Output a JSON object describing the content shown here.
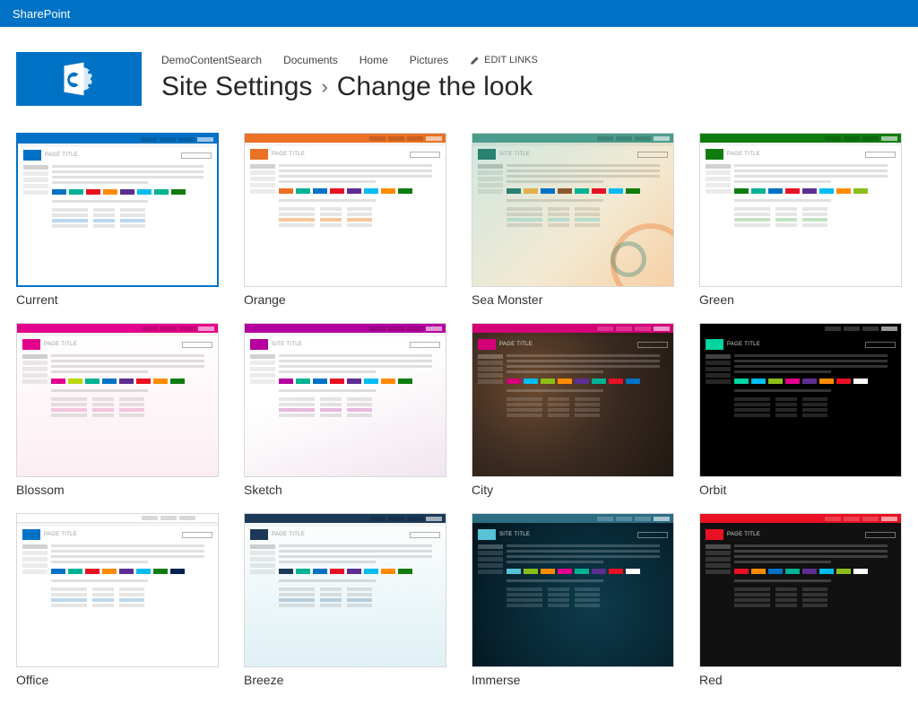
{
  "suitebar": {
    "brand": "SharePoint"
  },
  "topnav": {
    "items": [
      "DemoContentSearch",
      "Documents",
      "Home",
      "Pictures"
    ],
    "edit_links": "EDIT LINKS"
  },
  "breadcrumb": {
    "parent": "Site Settings",
    "current": "Change the look"
  },
  "preview_strings": {
    "page_title": "PAGE TITLE",
    "site_title": "SITE TITLE"
  },
  "themes": [
    {
      "name": "Current",
      "selected": true,
      "dark": false,
      "bg": "#ffffff",
      "topbar": "#0072c6",
      "accent": "#0072c6",
      "title_style": "page",
      "hl": "#bcd8ee",
      "swatches": [
        "#0072c6",
        "#00b294",
        "#e81123",
        "#ff8c00",
        "#5c2e91",
        "#00bcf2",
        "#00b294",
        "#107c10"
      ]
    },
    {
      "name": "Orange",
      "selected": false,
      "dark": false,
      "bg": "#ffffff",
      "topbar": "#ea7125",
      "accent": "#ea7125",
      "title_style": "page",
      "hl": "#f6c79a",
      "swatches": [
        "#ea7125",
        "#00b294",
        "#0072c6",
        "#e81123",
        "#5c2e91",
        "#00bcf2",
        "#ff8c00",
        "#107c10"
      ]
    },
    {
      "name": "Sea Monster",
      "selected": false,
      "dark": false,
      "bg": "linear-gradient(135deg,#cfe8e1 0%, #f3e9d2 60%, #f6d0a5 100%)",
      "deco": "sea",
      "topbar": "#4a9c8c",
      "accent": "#2a8071",
      "title_style": "site",
      "hl": "#b7dccf",
      "swatches": [
        "#2a8071",
        "#e3b04b",
        "#0072c6",
        "#8a5a2c",
        "#00b294",
        "#e81123",
        "#00bcf2",
        "#107c10"
      ]
    },
    {
      "name": "Green",
      "selected": false,
      "dark": false,
      "bg": "#ffffff",
      "topbar": "#107c10",
      "accent": "#107c10",
      "title_style": "page",
      "hl": "#c2e3c2",
      "swatches": [
        "#107c10",
        "#00b294",
        "#0072c6",
        "#e81123",
        "#5c2e91",
        "#00bcf2",
        "#ff8c00",
        "#8cbd18"
      ]
    },
    {
      "name": "Blossom",
      "selected": false,
      "dark": false,
      "bg": "linear-gradient(180deg,#ffffff 0%, #fceef2 100%)",
      "topbar": "#e3008c",
      "accent": "#e3008c",
      "title_style": "page",
      "hl": "#f4c4dc",
      "swatches": [
        "#e3008c",
        "#bad80a",
        "#00b294",
        "#0072c6",
        "#5c2e91",
        "#e81123",
        "#ff8c00",
        "#107c10"
      ]
    },
    {
      "name": "Sketch",
      "selected": false,
      "dark": false,
      "bg": "linear-gradient(160deg,#ffffff 40%, #f2e6ef 100%)",
      "topbar": "#b4009e",
      "accent": "#b4009e",
      "title_style": "site",
      "hl": "#e6b9de",
      "swatches": [
        "#b4009e",
        "#00b294",
        "#0072c6",
        "#e81123",
        "#5c2e91",
        "#00bcf2",
        "#ff8c00",
        "#107c10"
      ]
    },
    {
      "name": "City",
      "selected": false,
      "dark": true,
      "bg": "radial-gradient(circle at 30% 40%, #6b4a2f 0%, #3a2a20 50%, #1f1812 100%)",
      "topbar": "#d40078",
      "accent": "#d40078",
      "title_style": "page",
      "hl": "#7a4a62",
      "swatches": [
        "#d40078",
        "#00bcf2",
        "#8cbd18",
        "#ff8c00",
        "#5c2e91",
        "#00b294",
        "#e81123",
        "#0072c6"
      ]
    },
    {
      "name": "Orbit",
      "selected": false,
      "dark": true,
      "bg": "#000000",
      "topbar": "#000000",
      "accent": "#00d4a0",
      "title_style": "page",
      "hl": "#0e6b54",
      "swatches": [
        "#00d4a0",
        "#00bcf2",
        "#8cbd18",
        "#e3008c",
        "#5c2e91",
        "#ff8c00",
        "#e81123",
        "#ffffff"
      ]
    },
    {
      "name": "Office",
      "selected": false,
      "dark": false,
      "bg": "#ffffff",
      "topbar": "#ffffff",
      "accent": "#0072c6",
      "title_style": "page",
      "hl": "#bcd8ee",
      "topbar_border": "#e0e0e0",
      "swatches": [
        "#0072c6",
        "#00b294",
        "#e81123",
        "#ff8c00",
        "#5c2e91",
        "#00bcf2",
        "#107c10",
        "#002050"
      ]
    },
    {
      "name": "Breeze",
      "selected": false,
      "dark": false,
      "bg": "linear-gradient(180deg,#ffffff 0%, #dff0f5 100%)",
      "topbar": "#1b3a57",
      "accent": "#1b3a57",
      "title_style": "page",
      "hl": "#b9cddb",
      "swatches": [
        "#1b3a57",
        "#00b294",
        "#0072c6",
        "#e81123",
        "#5c2e91",
        "#00bcf2",
        "#ff8c00",
        "#107c10"
      ]
    },
    {
      "name": "Immerse",
      "selected": false,
      "dark": true,
      "bg": "radial-gradient(circle at 60% 60%, #0e3b4c 0%, #06212d 70%, #02121a 100%)",
      "topbar": "#2b6e84",
      "accent": "#56c3d6",
      "title_style": "site",
      "hl": "#2e788e",
      "swatches": [
        "#56c3d6",
        "#8cbd18",
        "#ff8c00",
        "#e3008c",
        "#00b294",
        "#5c2e91",
        "#e81123",
        "#ffffff"
      ]
    },
    {
      "name": "Red",
      "selected": false,
      "dark": true,
      "bg": "#111111",
      "topbar": "#e81123",
      "accent": "#e81123",
      "title_style": "page",
      "hl": "#7a2a30",
      "swatches": [
        "#e81123",
        "#ff8c00",
        "#0072c6",
        "#00b294",
        "#5c2e91",
        "#00bcf2",
        "#8cbd18",
        "#ffffff"
      ]
    }
  ]
}
